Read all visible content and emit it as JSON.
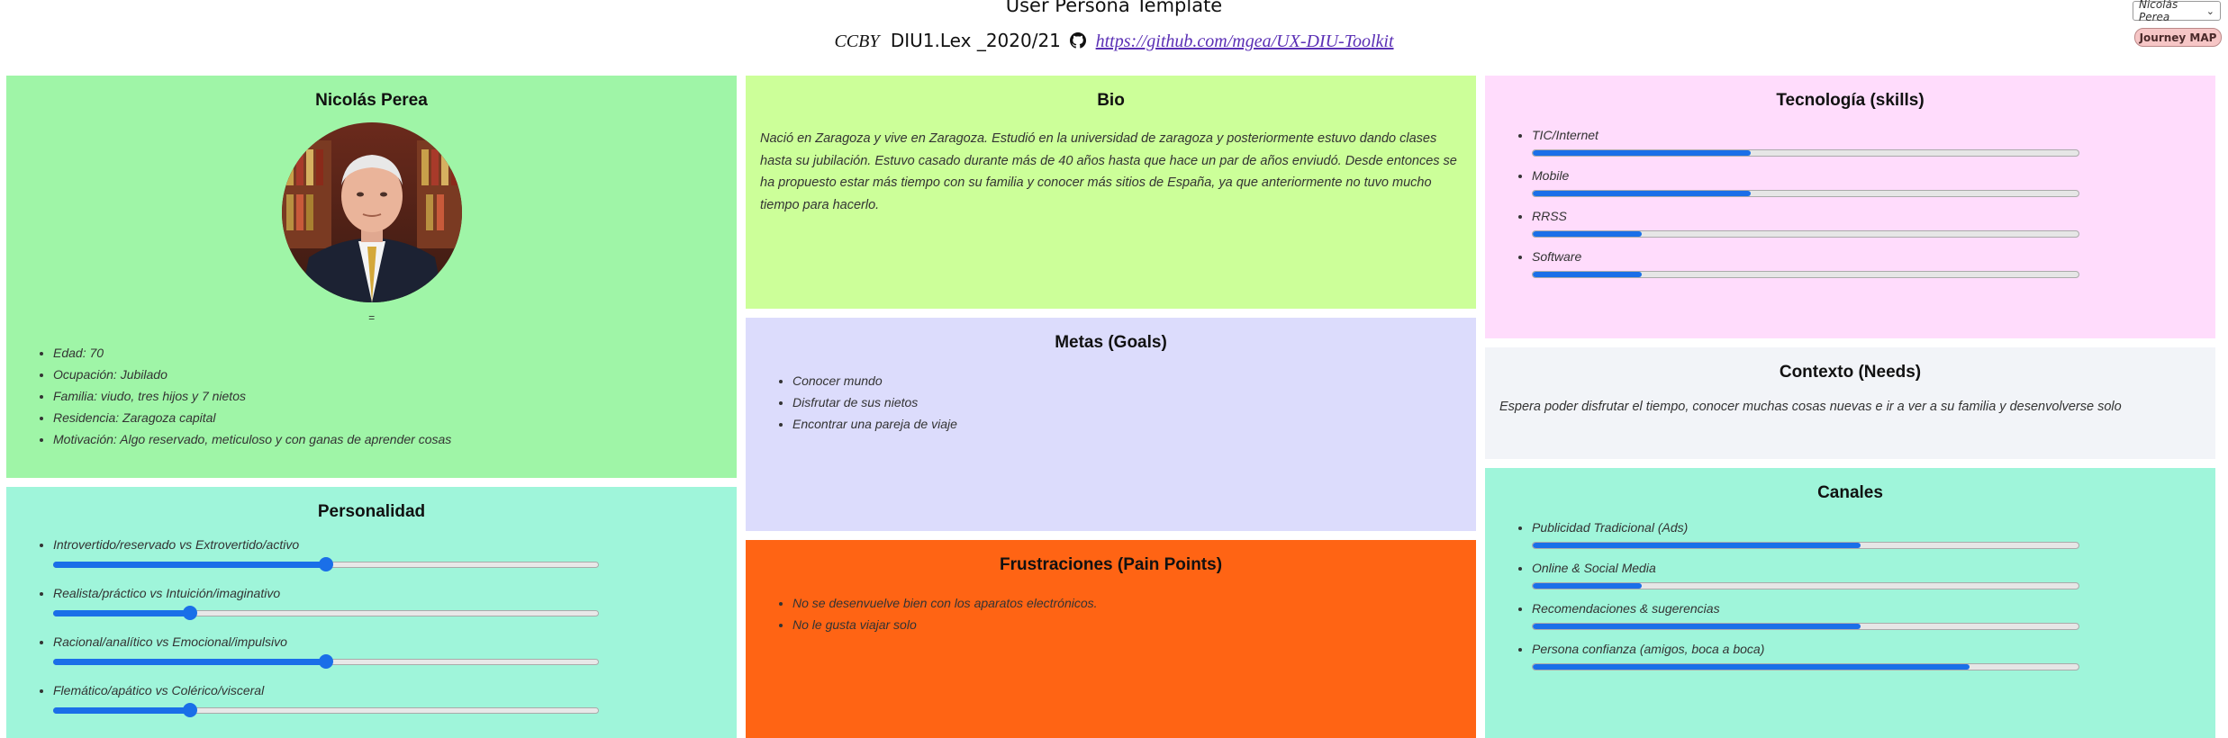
{
  "header": {
    "title": "User Persona Template",
    "cc": "CCBY",
    "course": "DIU1.Lex _2020/21",
    "repo_link": "https://github.com/mgea/UX-DIU-Toolkit"
  },
  "controls": {
    "persona_selected": "Nicolás Perea",
    "journey_button": "Journey MAP"
  },
  "profile": {
    "name": "Nicolás Perea",
    "avatar_caption": "=",
    "details": [
      "Edad: 70",
      "Ocupación: Jubilado",
      "Familia: viudo, tres hijos y 7 nietos",
      "Residencia: Zaragoza capital",
      "Motivación: Algo reservado, meticuloso y con ganas de aprender cosas"
    ]
  },
  "personality": {
    "title": "Personalidad",
    "traits": [
      {
        "label": "Introvertido/reservado vs Extrovertido/activo",
        "value": 50
      },
      {
        "label": "Realista/práctico vs Intuición/imaginativo",
        "value": 25
      },
      {
        "label": "Racional/analítico vs Emocional/impulsivo",
        "value": 50
      },
      {
        "label": "Flemático/apático vs Colérico/visceral",
        "value": 25
      }
    ]
  },
  "bio": {
    "title": "Bio",
    "text": "Nació en Zaragoza y vive en Zaragoza. Estudió en la universidad de zaragoza y posteriormente estuvo dando clases hasta su jubilación. Estuvo casado durante más de 40 años hasta que hace un par de años enviudó. Desde entonces se ha propuesto estar más tiempo con su familia y conocer más sitios de España, ya que anteriormente no tuvo mucho tiempo para hacerlo."
  },
  "goals": {
    "title": "Metas (Goals)",
    "items": [
      "Conocer mundo",
      "Disfrutar de sus nietos",
      "Encontrar una pareja de viaje"
    ]
  },
  "frustrations": {
    "title": "Frustraciones (Pain Points)",
    "items": [
      "No se desenvuelve bien con los aparatos electrónicos.",
      "No le gusta viajar solo"
    ]
  },
  "skills": {
    "title": "Tecnología (skills)",
    "items": [
      {
        "label": "TIC/Internet",
        "value": 40
      },
      {
        "label": "Mobile",
        "value": 40
      },
      {
        "label": "RRSS",
        "value": 20
      },
      {
        "label": "Software",
        "value": 20
      }
    ]
  },
  "needs": {
    "title": "Contexto (Needs)",
    "text": "Espera poder disfrutar el tiempo, conocer muchas cosas nuevas e ir a ver a su familia y desenvolverse solo"
  },
  "channels": {
    "title": "Canales",
    "items": [
      {
        "label": "Publicidad Tradicional (Ads)",
        "value": 60
      },
      {
        "label": "Online & Social Media",
        "value": 20
      },
      {
        "label": "Recomendaciones & sugerencias",
        "value": 60
      },
      {
        "label": "Persona confianza (amigos, boca a boca)",
        "value": 80
      }
    ]
  },
  "colors": {
    "profile_bg": "#9ff5a7",
    "personality_bg": "#9ff5da",
    "bio_bg": "#ccff99",
    "goals_bg": "#dcdcfc",
    "frustrations_bg": "#ff6414",
    "skills_bg": "#ffdcfc",
    "needs_bg": "#f2f4f8",
    "channels_bg": "#9ff5da",
    "accent": "#1a6fe8"
  }
}
